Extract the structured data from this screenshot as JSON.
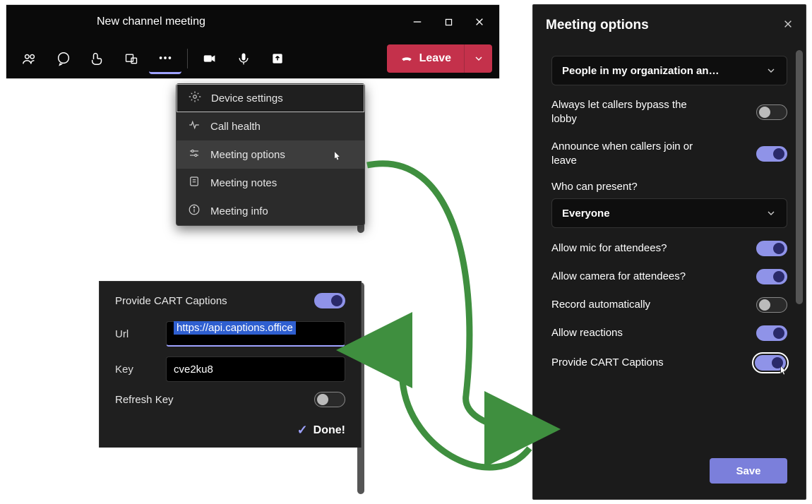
{
  "meeting": {
    "title": "New channel meeting",
    "leave_label": "Leave"
  },
  "menu": {
    "items": [
      {
        "label": "Device settings"
      },
      {
        "label": "Call health"
      },
      {
        "label": "Meeting options"
      },
      {
        "label": "Meeting notes"
      },
      {
        "label": "Meeting info"
      }
    ]
  },
  "cart": {
    "title": "Provide CART Captions",
    "url_label": "Url",
    "url_value": "https://api.captions.office",
    "key_label": "Key",
    "key_value": "cve2ku8",
    "refresh_label": "Refresh Key",
    "done_label": "Done!"
  },
  "options": {
    "header": "Meeting options",
    "lobby_dropdown": "People in my organization an…",
    "rows": {
      "bypass": "Always let callers bypass the lobby",
      "announce": "Announce when callers join or leave",
      "present_label": "Who can present?",
      "present_value": "Everyone",
      "mic": "Allow mic for attendees?",
      "camera": "Allow camera for attendees?",
      "record": "Record automatically",
      "reactions": "Allow reactions",
      "cart": "Provide CART Captions"
    },
    "toggles": {
      "bypass": false,
      "announce": true,
      "mic": true,
      "camera": true,
      "record": false,
      "reactions": true,
      "cart": true
    },
    "save_label": "Save"
  }
}
